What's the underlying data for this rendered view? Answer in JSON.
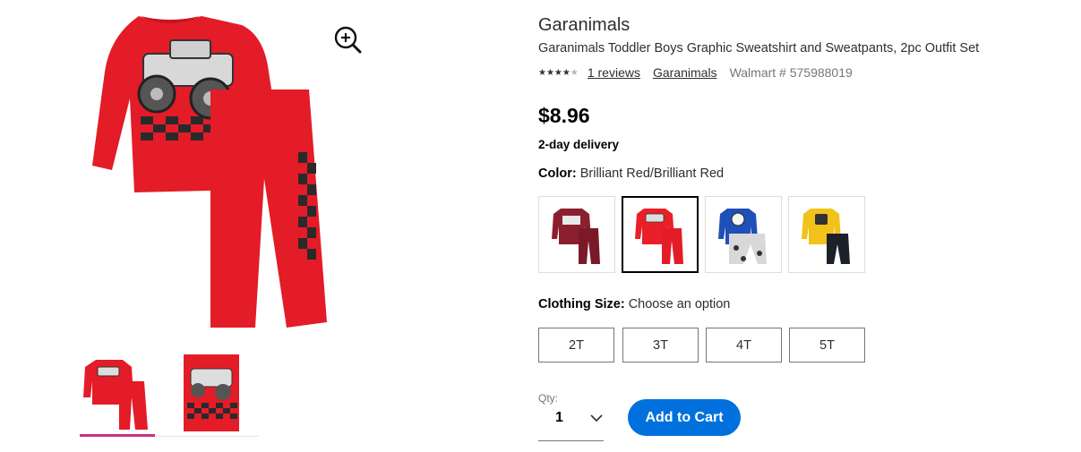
{
  "product": {
    "brand": "Garanimals",
    "title": "Garanimals Toddler Boys Graphic Sweatshirt and Sweatpants, 2pc Outfit Set",
    "rating_stars_filled": 4,
    "rating_stars_total": 5,
    "reviews_link": "1 reviews",
    "brand_link": "Garanimals",
    "item_number": "Walmart # 575988019",
    "price": "$8.96",
    "delivery": "2-day delivery"
  },
  "gallery": {
    "zoom_icon": "zoom-in-icon",
    "thumbnails": [
      "outfit-front",
      "sweatshirt-closeup"
    ],
    "active_thumbnail": 0,
    "active_color": "#c72f8e"
  },
  "color": {
    "label": "Color:",
    "value": "Brilliant Red/Brilliant Red",
    "swatches": [
      {
        "name": "maroon-outfit",
        "shirt": "#8b1f2e",
        "pants": "#7a1a28",
        "selected": false
      },
      {
        "name": "red-outfit",
        "shirt": "#e8202a",
        "pants": "#e31c27",
        "selected": true
      },
      {
        "name": "blue-outfit",
        "shirt": "#1f4fb8",
        "pants": "#d8d8d8",
        "selected": false
      },
      {
        "name": "yellow-outfit",
        "shirt": "#f2c21b",
        "pants": "#1c2028",
        "selected": false
      }
    ]
  },
  "size": {
    "label": "Clothing Size:",
    "value": "Choose an option",
    "options": [
      "2T",
      "3T",
      "4T",
      "5T"
    ]
  },
  "quantity": {
    "label": "Qty:",
    "value": "1"
  },
  "cart": {
    "button_label": "Add to Cart",
    "button_color": "#0071dc"
  }
}
